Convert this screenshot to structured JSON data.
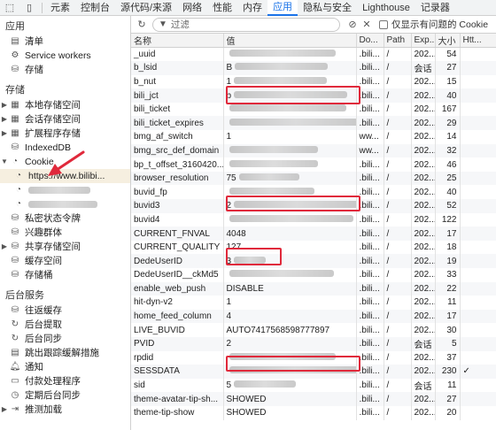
{
  "tabs": [
    "元素",
    "控制台",
    "源代码/来源",
    "网络",
    "性能",
    "内存",
    "应用",
    "隐私与安全",
    "Lighthouse",
    "记录器"
  ],
  "active_tab": "应用",
  "sidebar": {
    "app_title": "应用",
    "app_items": [
      "清单",
      "Service workers",
      "存储"
    ],
    "storage_title": "存储",
    "storage_items": [
      "本地存储空间",
      "会话存储空间",
      "扩展程序存储",
      "IndexedDB",
      "Cookie"
    ],
    "cookie_url": "https://www.bilibi...",
    "storage_items2": [
      "私密状态令牌",
      "兴趣群体",
      "共享存储空间",
      "缓存空间",
      "存储桶"
    ],
    "bg_title": "后台服务",
    "bg_items": [
      "往返缓存",
      "后台提取",
      "后台同步",
      "跳出跟踪缓解措施",
      "通知",
      "付款处理程序",
      "定期后台同步",
      "推测加载"
    ]
  },
  "filter": {
    "placeholder": "过滤",
    "checkbox_label": "仅显示有问题的 Cookie"
  },
  "table": {
    "columns": [
      "名称",
      "值",
      "Do...",
      "Path",
      "Exp...",
      "大小",
      "Htt..."
    ],
    "rows": [
      {
        "name": "_uuid",
        "value": "",
        "domain": ".bili...",
        "path": "/",
        "exp": "202...",
        "size": "54",
        "http": ""
      },
      {
        "name": "b_lsid",
        "value": "B",
        "domain": ".bili...",
        "path": "/",
        "exp": "会话",
        "size": "27",
        "http": ""
      },
      {
        "name": "b_nut",
        "value": "1",
        "domain": ".bili...",
        "path": "/",
        "exp": "202...",
        "size": "15",
        "http": ""
      },
      {
        "name": "bili_jct",
        "value": "b",
        "domain": ".bili...",
        "path": "/",
        "exp": "202...",
        "size": "40",
        "http": ""
      },
      {
        "name": "bili_ticket",
        "value": "",
        "domain": ".bili...",
        "path": "/",
        "exp": "202...",
        "size": "167",
        "http": ""
      },
      {
        "name": "bili_ticket_expires",
        "value": "",
        "domain": ".bili...",
        "path": "/",
        "exp": "202...",
        "size": "29",
        "http": ""
      },
      {
        "name": "bmg_af_switch",
        "value": "1",
        "domain": "ww...",
        "path": "/",
        "exp": "202...",
        "size": "14",
        "http": ""
      },
      {
        "name": "bmg_src_def_domain",
        "value": "",
        "domain": "ww...",
        "path": "/",
        "exp": "202...",
        "size": "32",
        "http": ""
      },
      {
        "name": "bp_t_offset_3160420...",
        "value": "",
        "domain": ".bili...",
        "path": "/",
        "exp": "202...",
        "size": "46",
        "http": ""
      },
      {
        "name": "browser_resolution",
        "value": "75",
        "domain": ".bili...",
        "path": "/",
        "exp": "202...",
        "size": "25",
        "http": ""
      },
      {
        "name": "buvid_fp",
        "value": "",
        "domain": ".bili...",
        "path": "/",
        "exp": "202...",
        "size": "40",
        "http": ""
      },
      {
        "name": "buvid3",
        "value": "2",
        "domain": ".bili...",
        "path": "/",
        "exp": "202...",
        "size": "52",
        "http": ""
      },
      {
        "name": "buvid4",
        "value": "",
        "domain": ".bili...",
        "path": "/",
        "exp": "202...",
        "size": "122",
        "http": ""
      },
      {
        "name": "CURRENT_FNVAL",
        "value": "4048",
        "domain": ".bili...",
        "path": "/",
        "exp": "202...",
        "size": "17",
        "http": ""
      },
      {
        "name": "CURRENT_QUALITY",
        "value": "127",
        "domain": ".bili...",
        "path": "/",
        "exp": "202...",
        "size": "18",
        "http": ""
      },
      {
        "name": "DedeUserID",
        "value": "3",
        "domain": ".bili...",
        "path": "/",
        "exp": "202...",
        "size": "19",
        "http": ""
      },
      {
        "name": "DedeUserID__ckMd5",
        "value": "",
        "domain": ".bili...",
        "path": "/",
        "exp": "202...",
        "size": "33",
        "http": ""
      },
      {
        "name": "enable_web_push",
        "value": "DISABLE",
        "domain": ".bili...",
        "path": "/",
        "exp": "202...",
        "size": "22",
        "http": ""
      },
      {
        "name": "hit-dyn-v2",
        "value": "1",
        "domain": ".bili...",
        "path": "/",
        "exp": "202...",
        "size": "11",
        "http": ""
      },
      {
        "name": "home_feed_column",
        "value": "4",
        "domain": ".bili...",
        "path": "/",
        "exp": "202...",
        "size": "17",
        "http": ""
      },
      {
        "name": "LIVE_BUVID",
        "value": "AUTO7417568598777897",
        "domain": ".bili...",
        "path": "/",
        "exp": "202...",
        "size": "30",
        "http": ""
      },
      {
        "name": "PVID",
        "value": "2",
        "domain": ".bili...",
        "path": "/",
        "exp": "会话",
        "size": "5",
        "http": ""
      },
      {
        "name": "rpdid",
        "value": "",
        "domain": ".bili...",
        "path": "/",
        "exp": "202...",
        "size": "37",
        "http": ""
      },
      {
        "name": "SESSDATA",
        "value": "",
        "domain": ".bili...",
        "path": "/",
        "exp": "202...",
        "size": "230",
        "http": "✓"
      },
      {
        "name": "sid",
        "value": "5",
        "domain": ".bili...",
        "path": "/",
        "exp": "会话",
        "size": "11",
        "http": ""
      },
      {
        "name": "theme-avatar-tip-sh...",
        "value": "SHOWED",
        "domain": ".bili...",
        "path": "/",
        "exp": "202...",
        "size": "27",
        "http": ""
      },
      {
        "name": "theme-tip-show",
        "value": "SHOWED",
        "domain": ".bili...",
        "path": "/",
        "exp": "202...",
        "size": "20",
        "http": ""
      }
    ]
  }
}
